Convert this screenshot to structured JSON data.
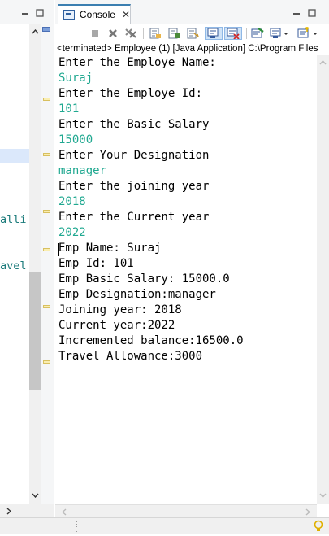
{
  "left_panel": {
    "code_fragments": [
      {
        "text": "alli"
      },
      {
        "text": "avel"
      }
    ]
  },
  "console": {
    "tab_label": "Console",
    "process_label": "<terminated> Employee (1) [Java Application] C:\\Program Files",
    "lines": [
      {
        "text": "Enter the Employe Name:",
        "kind": "prompt"
      },
      {
        "text": "Suraj",
        "kind": "input"
      },
      {
        "text": "Enter the Employe Id:",
        "kind": "prompt"
      },
      {
        "text": "101",
        "kind": "input"
      },
      {
        "text": "Enter the Basic Salary",
        "kind": "prompt"
      },
      {
        "text": "15000",
        "kind": "input"
      },
      {
        "text": "Enter Your Designation",
        "kind": "prompt"
      },
      {
        "text": "manager",
        "kind": "input"
      },
      {
        "text": "Enter the joining year",
        "kind": "prompt"
      },
      {
        "text": "2018",
        "kind": "input"
      },
      {
        "text": "Enter the Current year",
        "kind": "prompt"
      },
      {
        "text": "2022",
        "kind": "input"
      },
      {
        "text": "Emp Name: Suraj",
        "kind": "out"
      },
      {
        "text": "Emp Id: 101",
        "kind": "out"
      },
      {
        "text": "Emp Basic Salary: 15000.0",
        "kind": "out"
      },
      {
        "text": "Emp Designation:manager",
        "kind": "out"
      },
      {
        "text": "Joining year: 2018",
        "kind": "out"
      },
      {
        "text": "Current year:2022",
        "kind": "out"
      },
      {
        "text": "Incremented balance:16500.0",
        "kind": "out"
      },
      {
        "text": "Travel Allowance:3000",
        "kind": "out"
      }
    ]
  },
  "colors": {
    "input_text": "#1fa890",
    "code_text": "#1a7a7a",
    "active_tab_border": "#3c7fb1"
  },
  "icons": {
    "window_controls": [
      "minimize-icon",
      "maximize-icon"
    ],
    "toolbar": [
      "stop-icon",
      "remove-launch-icon",
      "remove-all-terminated-icon",
      "clear-console-icon",
      "scroll-lock-icon",
      "word-wrap-icon",
      "show-on-stdout-icon",
      "show-on-stderr-icon",
      "pin-console-icon",
      "display-console-icon",
      "open-console-icon"
    ]
  }
}
